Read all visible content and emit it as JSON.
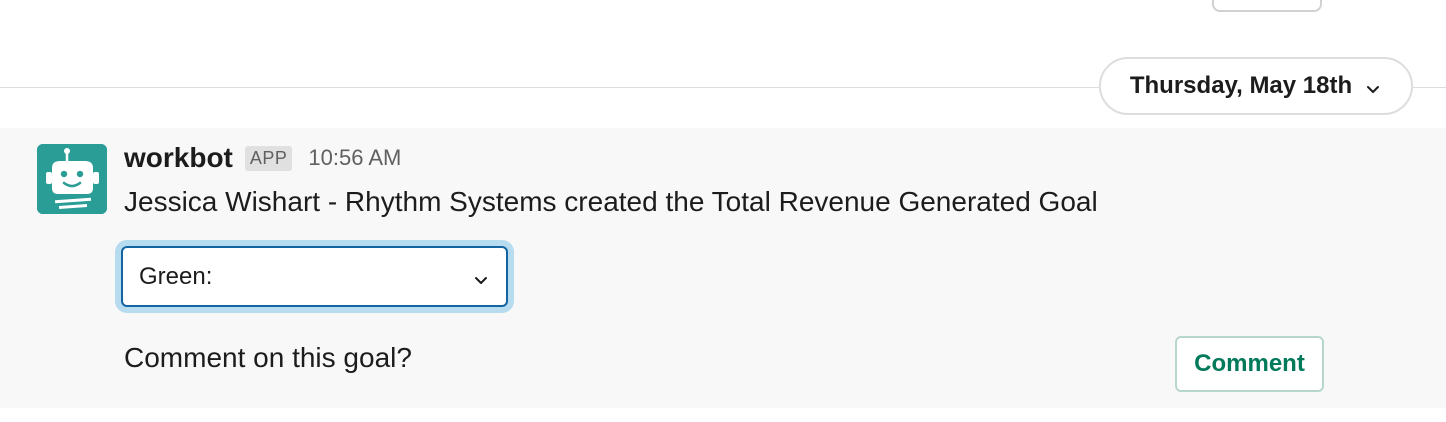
{
  "day_divider": {
    "label": "Thursday, May 18th",
    "icon": "chevron-down-icon"
  },
  "message": {
    "sender": "workbot",
    "badge": "APP",
    "timestamp": "10:56 AM",
    "text": "Jessica Wishart - Rhythm Systems created the Total Revenue Generated Goal",
    "avatar_icon": "robot-icon",
    "avatar_color": "#2a9d97",
    "select": {
      "value": "Green:",
      "icon": "chevron-down-icon"
    },
    "comment_prompt": "Comment on this goal?",
    "comment_button": "Comment"
  },
  "colors": {
    "focus_ring": "#b7dbef",
    "select_border": "#1264a3",
    "comment_button_text": "#007a5a",
    "message_bg": "#f8f8f8"
  }
}
